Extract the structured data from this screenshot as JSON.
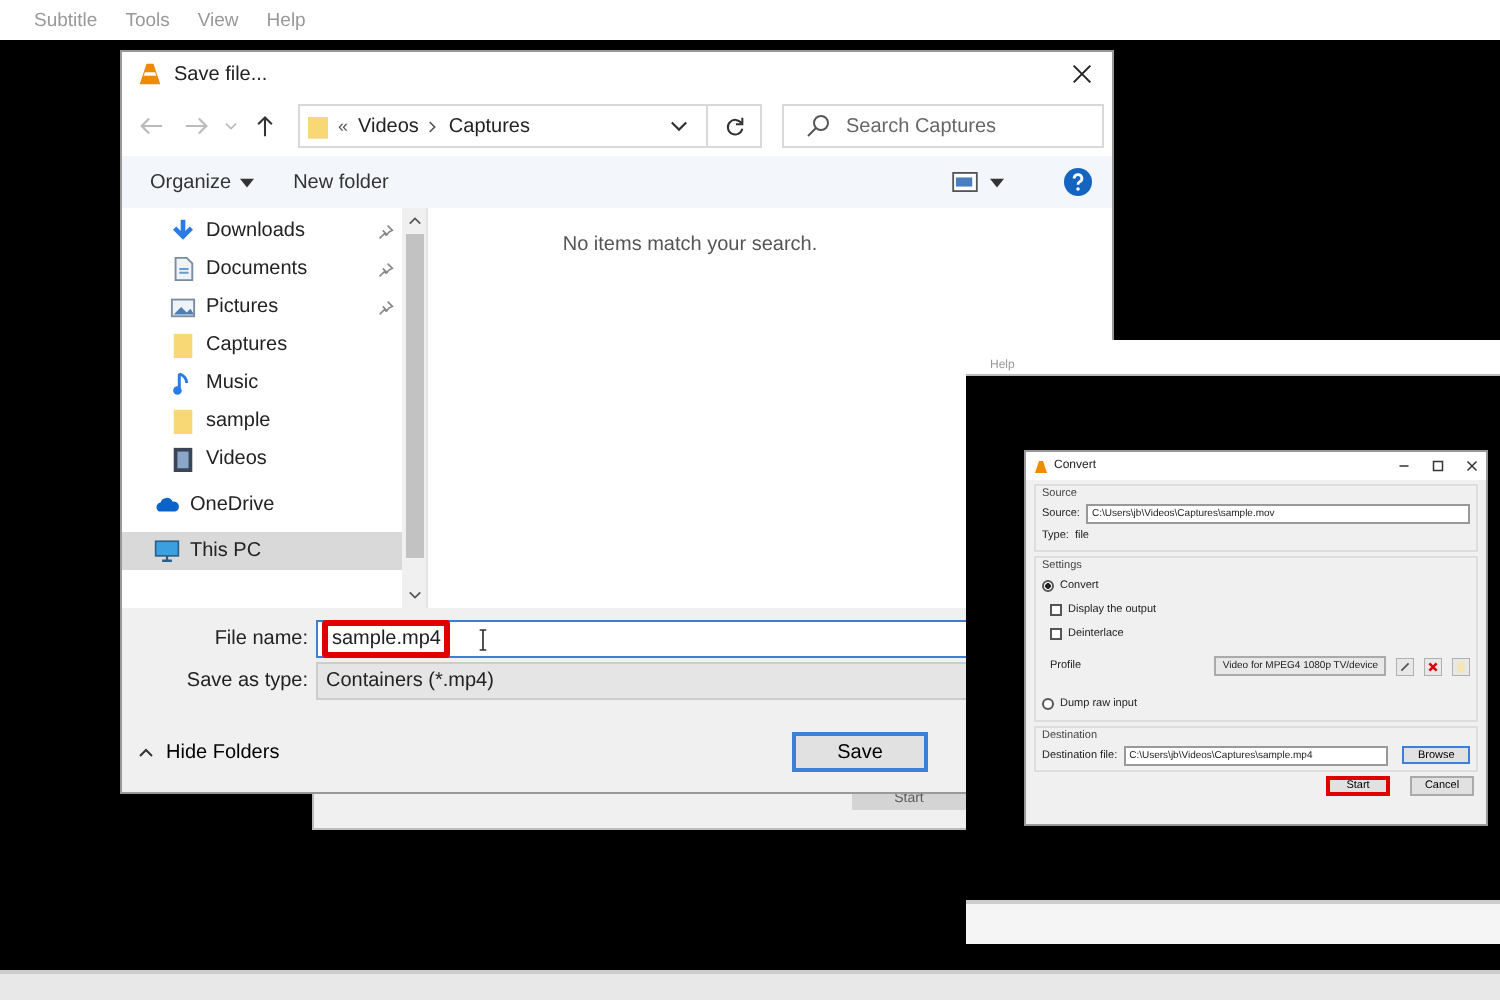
{
  "menu_bar": {
    "items": [
      "Subtitle",
      "Tools",
      "View",
      "Help"
    ]
  },
  "save_dialog": {
    "title": "Save file...",
    "address": {
      "overflow": "«",
      "parts": [
        "Videos",
        "Captures"
      ]
    },
    "search": {
      "placeholder": "Search Captures"
    },
    "toolbar": {
      "organize": "Organize",
      "new_folder": "New folder"
    },
    "nav_items": [
      {
        "label": "Downloads",
        "kind": "download",
        "pinned": true,
        "selected": false
      },
      {
        "label": "Documents",
        "kind": "document",
        "pinned": true,
        "selected": false
      },
      {
        "label": "Pictures",
        "kind": "pictures",
        "pinned": true,
        "selected": false
      },
      {
        "label": "Captures",
        "kind": "folder",
        "pinned": false,
        "selected": false
      },
      {
        "label": "Music",
        "kind": "music",
        "pinned": false,
        "selected": false
      },
      {
        "label": "sample",
        "kind": "folder",
        "pinned": false,
        "selected": false
      },
      {
        "label": "Videos",
        "kind": "video",
        "pinned": false,
        "selected": false
      },
      {
        "label": "OneDrive",
        "kind": "cloud",
        "pinned": false,
        "selected": false
      },
      {
        "label": "This PC",
        "kind": "pc",
        "pinned": false,
        "selected": true
      }
    ],
    "empty_message": "No items match your search.",
    "file_name": {
      "label": "File name:",
      "value": "sample.mp4",
      "highlighted": true
    },
    "save_as_type": {
      "label": "Save as type:",
      "value": "Containers (*.mp4)"
    },
    "hide_folders": "Hide Folders",
    "save_button": "Save"
  },
  "background_window": {
    "start_button": {
      "label": "Start",
      "disabled": true
    }
  },
  "inset": {
    "menu_items": [
      "Help"
    ],
    "convert_dialog": {
      "title": "Convert",
      "source_group": "Source",
      "source_label": "Source:",
      "source_value": "C:\\Users\\jb\\Videos\\Captures\\sample.mov",
      "type_label": "Type:",
      "type_value": "file",
      "settings_group": "Settings",
      "options": [
        {
          "kind": "radio",
          "label": "Convert",
          "selected": true
        },
        {
          "kind": "checkbox",
          "label": "Display the output",
          "checked": false
        },
        {
          "kind": "checkbox",
          "label": "Deinterlace",
          "checked": false
        },
        {
          "kind": "profile",
          "label": "Profile",
          "value": "Video for MPEG4 1080p TV/device"
        },
        {
          "kind": "radio",
          "label": "Dump raw input",
          "selected": false
        }
      ],
      "destination_group": "Destination",
      "destination_label": "Destination file:",
      "destination_value": "C:\\Users\\jb\\Videos\\Captures\\sample.mp4",
      "browse": "Browse",
      "buttons": [
        {
          "label": "Start",
          "highlighted": true
        },
        {
          "label": "Cancel",
          "highlighted": false
        }
      ]
    }
  }
}
